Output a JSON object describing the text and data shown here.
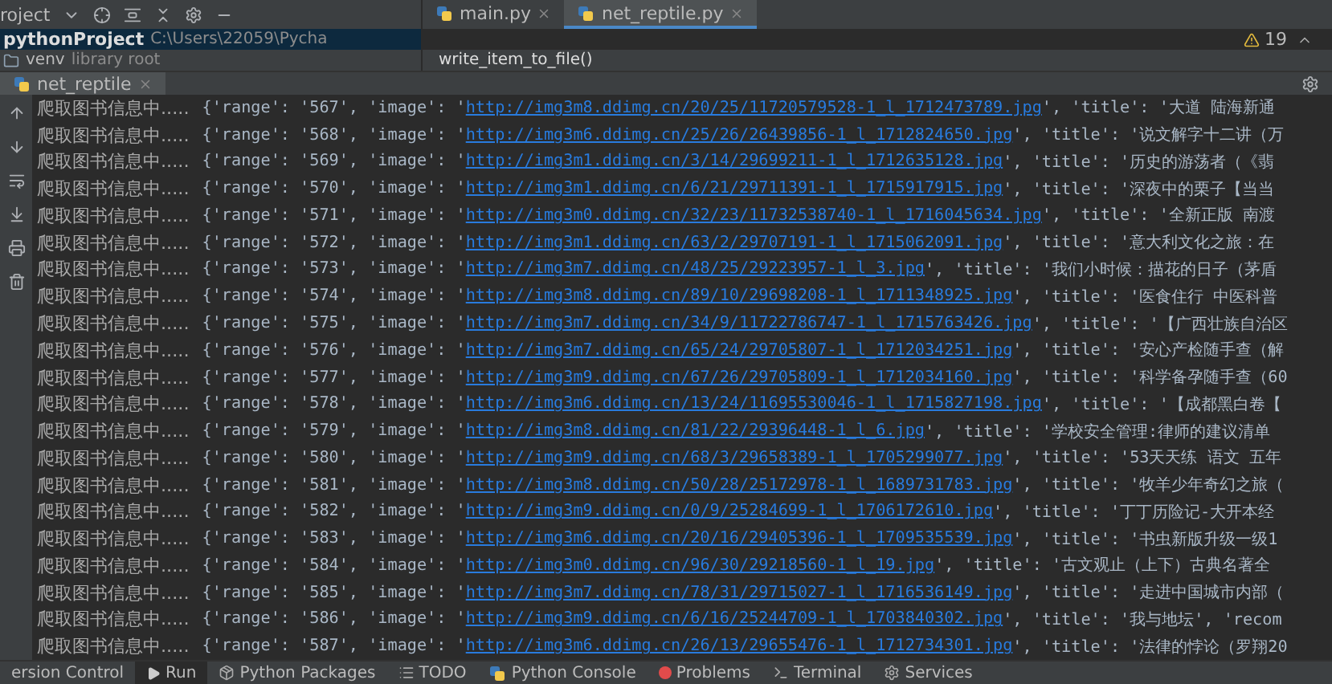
{
  "project_panel": {
    "title": "roject",
    "root": {
      "name": "pythonProject",
      "path": "C:\\Users\\22059\\Pycha",
      "selected": true
    },
    "children": [
      {
        "name": "venv",
        "note": "library root"
      }
    ]
  },
  "editor_tabs": [
    {
      "label": "main.py",
      "selected": false
    },
    {
      "label": "net_reptile.py",
      "selected": true
    }
  ],
  "inspections": {
    "warnings": "19"
  },
  "tooltip": "write_item_to_file()",
  "run_tabs": [
    {
      "label": "net_reptile",
      "selected": true
    }
  ],
  "console_lines": [
    {
      "prefix": "爬取图书信息中.....",
      "before": "{'range': '567', 'image': '",
      "url": "http://img3m8.ddimg.cn/20/25/11720579528-1_l_1712473789.jpg",
      "after": "', 'title': '大道 陆海新通"
    },
    {
      "prefix": "爬取图书信息中.....",
      "before": "{'range': '568', 'image': '",
      "url": "http://img3m6.ddimg.cn/25/26/26439856-1_l_1712824650.jpg",
      "after": "', 'title': '说文解字十二讲（万"
    },
    {
      "prefix": "爬取图书信息中.....",
      "before": "{'range': '569', 'image': '",
      "url": "http://img3m1.ddimg.cn/3/14/29699211-1_l_1712635128.jpg",
      "after": "', 'title': '历史的游荡者（《翡"
    },
    {
      "prefix": "爬取图书信息中.....",
      "before": "{'range': '570', 'image': '",
      "url": "http://img3m1.ddimg.cn/6/21/29711391-1_l_1715917915.jpg",
      "after": "', 'title': '深夜中的栗子【当当"
    },
    {
      "prefix": "爬取图书信息中.....",
      "before": "{'range': '571', 'image': '",
      "url": "http://img3m0.ddimg.cn/32/23/11732538740-1_l_1716045634.jpg",
      "after": "', 'title': '全新正版 南渡"
    },
    {
      "prefix": "爬取图书信息中.....",
      "before": "{'range': '572', 'image': '",
      "url": "http://img3m1.ddimg.cn/63/2/29707191-1_l_1715062091.jpg",
      "after": "', 'title': '意大利文化之旅：在"
    },
    {
      "prefix": "爬取图书信息中.....",
      "before": "{'range': '573', 'image': '",
      "url": "http://img3m7.ddimg.cn/48/25/29223957-1_l_3.jpg",
      "after": "', 'title': '我们小时候：描花的日子（茅盾"
    },
    {
      "prefix": "爬取图书信息中.....",
      "before": "{'range': '574', 'image': '",
      "url": "http://img3m8.ddimg.cn/89/10/29698208-1_l_1711348925.jpg",
      "after": "', 'title': '医食住行 中医科普"
    },
    {
      "prefix": "爬取图书信息中.....",
      "before": "{'range': '575', 'image': '",
      "url": "http://img3m7.ddimg.cn/34/9/11722786747-1_l_1715763426.jpg",
      "after": "', 'title': '【广西壮族自治区"
    },
    {
      "prefix": "爬取图书信息中.....",
      "before": "{'range': '576', 'image': '",
      "url": "http://img3m7.ddimg.cn/65/24/29705807-1_l_1712034251.jpg",
      "after": "', 'title': '安心产检随手查（解"
    },
    {
      "prefix": "爬取图书信息中.....",
      "before": "{'range': '577', 'image': '",
      "url": "http://img3m9.ddimg.cn/67/26/29705809-1_l_1712034160.jpg",
      "after": "', 'title': '科学备孕随手查（60"
    },
    {
      "prefix": "爬取图书信息中.....",
      "before": "{'range': '578', 'image': '",
      "url": "http://img3m6.ddimg.cn/13/24/11695530046-1_l_1715827198.jpg",
      "after": "', 'title': '【成都黑白卷【"
    },
    {
      "prefix": "爬取图书信息中.....",
      "before": "{'range': '579', 'image': '",
      "url": "http://img3m8.ddimg.cn/81/22/29396448-1_l_6.jpg",
      "after": "', 'title': '学校安全管理:律师的建议清单"
    },
    {
      "prefix": "爬取图书信息中.....",
      "before": "{'range': '580', 'image': '",
      "url": "http://img3m9.ddimg.cn/68/3/29658389-1_l_1705299077.jpg",
      "after": "', 'title': '53天天练 语文 五年"
    },
    {
      "prefix": "爬取图书信息中.....",
      "before": "{'range': '581', 'image': '",
      "url": "http://img3m8.ddimg.cn/50/28/25172978-1_l_1689731783.jpg",
      "after": "', 'title': '牧羊少年奇幻之旅（"
    },
    {
      "prefix": "爬取图书信息中.....",
      "before": "{'range': '582', 'image': '",
      "url": "http://img3m9.ddimg.cn/0/9/25284699-1_l_1706172610.jpg",
      "after": "', 'title': '丁丁历险记-大开本经"
    },
    {
      "prefix": "爬取图书信息中.....",
      "before": "{'range': '583', 'image': '",
      "url": "http://img3m6.ddimg.cn/20/16/29405396-1_l_1709535539.jpg",
      "after": "', 'title': '书虫新版升级一级1"
    },
    {
      "prefix": "爬取图书信息中.....",
      "before": "{'range': '584', 'image': '",
      "url": "http://img3m0.ddimg.cn/96/30/29218560-1_l_19.jpg",
      "after": "', 'title': '古文观止（上下）古典名著全"
    },
    {
      "prefix": "爬取图书信息中.....",
      "before": "{'range': '585', 'image': '",
      "url": "http://img3m7.ddimg.cn/78/31/29715027-1_l_1716536149.jpg",
      "after": "', 'title': '走进中国城市内部（"
    },
    {
      "prefix": "爬取图书信息中.....",
      "before": "{'range': '586', 'image': '",
      "url": "http://img3m9.ddimg.cn/6/16/25244709-1_l_1703840302.jpg",
      "after": "', 'title': '我与地坛', 'recom"
    },
    {
      "prefix": "爬取图书信息中.....",
      "before": "{'range': '587', 'image': '",
      "url": "http://img3m6.ddimg.cn/26/13/29655476-1_l_1712734301.jpg",
      "after": "', 'title': '法律的悖论（罗翔20"
    }
  ],
  "tool_windows": [
    {
      "kind": "none",
      "label": "ersion Control",
      "selected": false
    },
    {
      "kind": "run",
      "label": "Run",
      "selected": true
    },
    {
      "kind": "packages",
      "label": "Python Packages",
      "selected": false
    },
    {
      "kind": "list",
      "label": "TODO",
      "selected": false
    },
    {
      "kind": "python",
      "label": "Python Console",
      "selected": false
    },
    {
      "kind": "problems",
      "label": "Problems",
      "selected": false
    },
    {
      "kind": "terminal",
      "label": "Terminal",
      "selected": false
    },
    {
      "kind": "services",
      "label": "Services",
      "selected": false
    }
  ]
}
